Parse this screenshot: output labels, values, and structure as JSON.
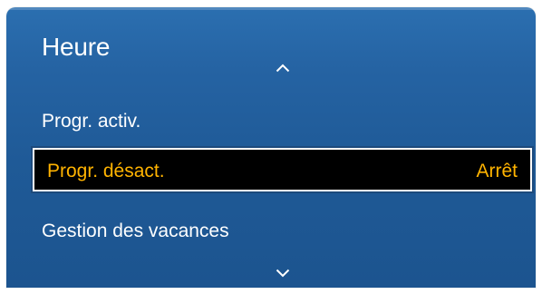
{
  "menu": {
    "title": "Heure",
    "items": [
      {
        "label": "Progr. activ."
      },
      {
        "label": "Progr. désact.",
        "value": "Arrêt",
        "selected": true
      },
      {
        "label": "Gestion des vacances"
      }
    ],
    "scroll_up_icon": "chevron-up-icon",
    "scroll_down_icon": "chevron-down-icon"
  },
  "colors": {
    "panel_background": "#2563a3",
    "highlight_background": "#000000",
    "highlight_text": "#ffb300",
    "text": "#ffffff"
  }
}
